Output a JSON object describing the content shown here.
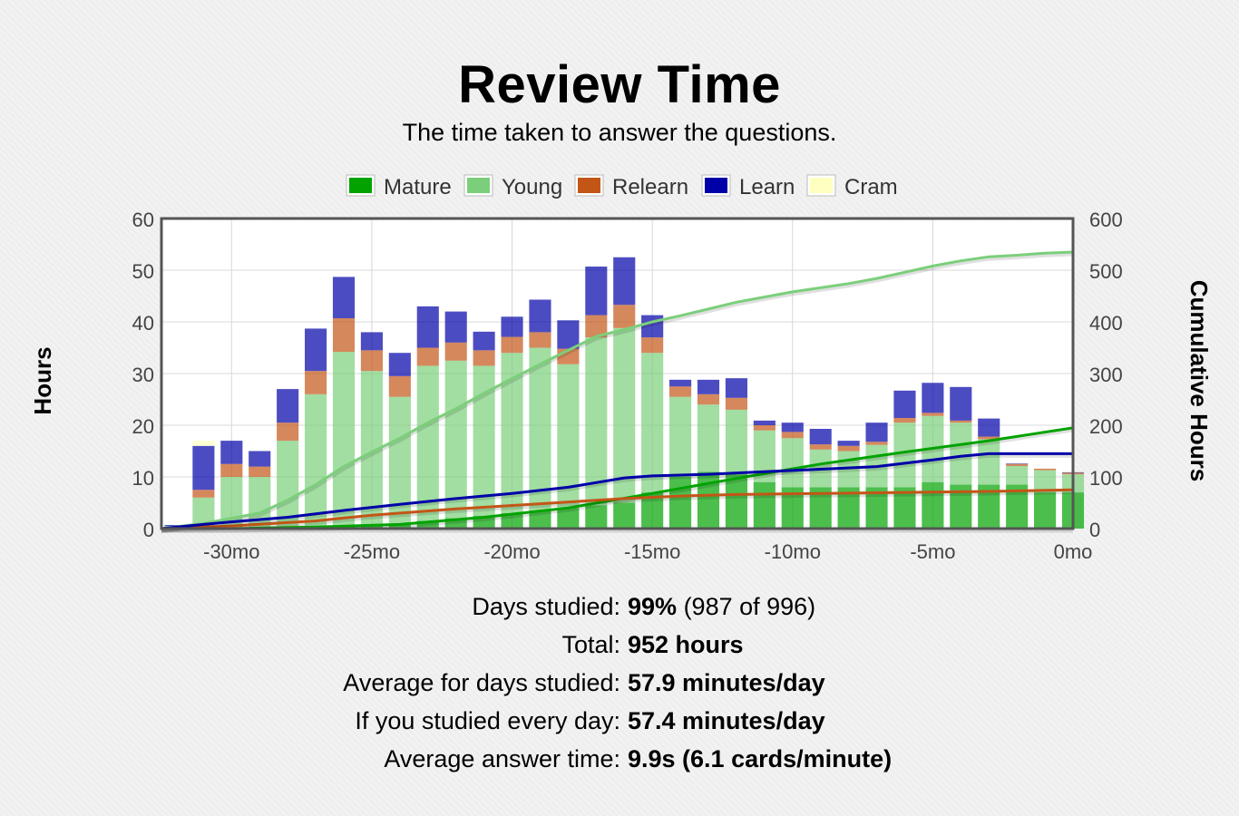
{
  "header": {
    "title": "Review Time",
    "subtitle": "The time taken to answer the questions."
  },
  "colors": {
    "mature": "#00a300",
    "young": "#7bcf7b",
    "relearn": "#c35617",
    "learn": "#0000a8",
    "cram": "#ffffc0"
  },
  "chart_data": {
    "type": "bar",
    "title": "Review Time",
    "subtitle": "The time taken to answer the questions.",
    "ylabel": "Hours",
    "y2label": "Cumulative Hours",
    "ylim": [
      0,
      60
    ],
    "y2lim": [
      0,
      600
    ],
    "xlim": [
      -32.5,
      0
    ],
    "x_ticks": [
      -30,
      -25,
      -20,
      -15,
      -10,
      -5,
      0
    ],
    "x_tick_labels": [
      "-30mo",
      "-25mo",
      "-20mo",
      "-15mo",
      "-10mo",
      "-5mo",
      "0mo"
    ],
    "y_ticks": [
      0,
      10,
      20,
      30,
      40,
      50,
      60
    ],
    "y2_ticks": [
      0,
      100,
      200,
      300,
      400,
      500,
      600
    ],
    "grid": true,
    "legend_position": "top",
    "stacked": true,
    "x": [
      -32,
      -31,
      -30,
      -29,
      -28,
      -27,
      -26,
      -25,
      -24,
      -23,
      -22,
      -21,
      -20,
      -19,
      -18,
      -17,
      -16,
      -15,
      -14,
      -13,
      -12,
      -11,
      -10,
      -9,
      -8,
      -7,
      -6,
      -5,
      -4,
      -3,
      -2,
      -1,
      0
    ],
    "series": [
      {
        "name": "Mature",
        "values": [
          0,
          0,
          0,
          0,
          0,
          0,
          0.2,
          0.5,
          1,
          1.5,
          2,
          2.5,
          3,
          3.5,
          4,
          4.5,
          5,
          7,
          10,
          11,
          10.5,
          9,
          8,
          8,
          8,
          8,
          8,
          9,
          8.5,
          8.5,
          8.5,
          7,
          7
        ]
      },
      {
        "name": "Young",
        "values": [
          0.5,
          6,
          10,
          10,
          17,
          26,
          34,
          30,
          24.5,
          30,
          30.5,
          29,
          31,
          31.5,
          27.8,
          32.5,
          33.8,
          27,
          15.5,
          13,
          12.5,
          10,
          9.5,
          7.3,
          7,
          8.2,
          12.5,
          12.8,
          12,
          8.8,
          3.6,
          4.3,
          3.5
        ]
      },
      {
        "name": "Relearn",
        "values": [
          0,
          1.5,
          2.5,
          2,
          3.5,
          4.5,
          6.5,
          4,
          4,
          3.5,
          3.5,
          3,
          3.1,
          3,
          3,
          4.3,
          4.5,
          3,
          2,
          2,
          2.3,
          1,
          1.2,
          1,
          1,
          0.6,
          0.9,
          0.6,
          0.4,
          0.5,
          0.4,
          0.3,
          0.3
        ]
      },
      {
        "name": "Learn",
        "values": [
          0.2,
          8.5,
          4.5,
          3,
          6.5,
          8.2,
          8,
          3.5,
          4.5,
          8,
          6,
          3.6,
          3.9,
          6.3,
          5.5,
          9.4,
          9.2,
          4.3,
          1.3,
          2.8,
          3.8,
          0.9,
          1.8,
          3,
          1,
          3.7,
          5.3,
          5.8,
          6.5,
          3.5,
          0.1,
          0,
          0.1
        ]
      },
      {
        "name": "Cram",
        "values": [
          0,
          1,
          0,
          0,
          0,
          0,
          0,
          0,
          0,
          0,
          0,
          0,
          0,
          0,
          0,
          0,
          0,
          0,
          0,
          0,
          0,
          0,
          0,
          0,
          0,
          0,
          0,
          0,
          0,
          0,
          0,
          0,
          0
        ]
      }
    ],
    "cumulative_axis": "right",
    "cumulative_series": [
      {
        "name": "Mature",
        "points": [
          [
            -32.5,
            0
          ],
          [
            -30,
            0
          ],
          [
            -27,
            3
          ],
          [
            -24,
            8
          ],
          [
            -21,
            22
          ],
          [
            -18,
            40
          ],
          [
            -15,
            68
          ],
          [
            -12,
            97
          ],
          [
            -9,
            125
          ],
          [
            -6,
            148
          ],
          [
            -3,
            170
          ],
          [
            0,
            195
          ]
        ]
      },
      {
        "name": "Young",
        "points": [
          [
            -32.5,
            0
          ],
          [
            -31,
            10
          ],
          [
            -30,
            20
          ],
          [
            -29,
            30
          ],
          [
            -28,
            55
          ],
          [
            -27,
            85
          ],
          [
            -26,
            120
          ],
          [
            -25,
            148
          ],
          [
            -24,
            175
          ],
          [
            -23,
            205
          ],
          [
            -22,
            232
          ],
          [
            -21,
            262
          ],
          [
            -20,
            290
          ],
          [
            -19,
            318
          ],
          [
            -18,
            345
          ],
          [
            -17,
            372
          ],
          [
            -16,
            385
          ],
          [
            -15,
            400
          ],
          [
            -14,
            412
          ],
          [
            -13,
            425
          ],
          [
            -12,
            438
          ],
          [
            -11,
            448
          ],
          [
            -10,
            458
          ],
          [
            -9,
            466
          ],
          [
            -8,
            474
          ],
          [
            -7,
            484
          ],
          [
            -6,
            496
          ],
          [
            -5,
            508
          ],
          [
            -4,
            518
          ],
          [
            -3,
            526
          ],
          [
            -2,
            529
          ],
          [
            -1,
            533
          ],
          [
            0,
            535
          ]
        ]
      },
      {
        "name": "Relearn",
        "points": [
          [
            -32.5,
            0
          ],
          [
            -30,
            5
          ],
          [
            -27,
            15
          ],
          [
            -25,
            26
          ],
          [
            -22,
            38
          ],
          [
            -19,
            48
          ],
          [
            -16,
            58
          ],
          [
            -14,
            63
          ],
          [
            -12,
            66
          ],
          [
            -9,
            68
          ],
          [
            -6,
            70
          ],
          [
            -3,
            72
          ],
          [
            0,
            75
          ]
        ]
      },
      {
        "name": "Learn",
        "points": [
          [
            -32.5,
            0
          ],
          [
            -31,
            8
          ],
          [
            -30,
            13
          ],
          [
            -28,
            22
          ],
          [
            -26,
            35
          ],
          [
            -24,
            47
          ],
          [
            -22,
            58
          ],
          [
            -20,
            68
          ],
          [
            -18,
            80
          ],
          [
            -16,
            98
          ],
          [
            -15,
            102
          ],
          [
            -13,
            105
          ],
          [
            -11,
            110
          ],
          [
            -9,
            115
          ],
          [
            -7,
            120
          ],
          [
            -5,
            133
          ],
          [
            -4,
            140
          ],
          [
            -3,
            145
          ],
          [
            0,
            145
          ]
        ]
      },
      {
        "name": "Cram",
        "points": [
          [
            -32.5,
            0
          ],
          [
            0,
            0
          ]
        ]
      }
    ]
  },
  "stats": [
    {
      "label": "Days studied:",
      "value": "99%",
      "extra": "(987 of 996)"
    },
    {
      "label": "Total:",
      "value": "952 hours",
      "extra": ""
    },
    {
      "label": "Average for days studied:",
      "value": "57.9 minutes/day",
      "extra": ""
    },
    {
      "label": "If you studied every day:",
      "value": "57.4 minutes/day",
      "extra": ""
    },
    {
      "label": "Average answer time:",
      "value": "9.9s (6.1 cards/minute)",
      "extra": ""
    }
  ]
}
